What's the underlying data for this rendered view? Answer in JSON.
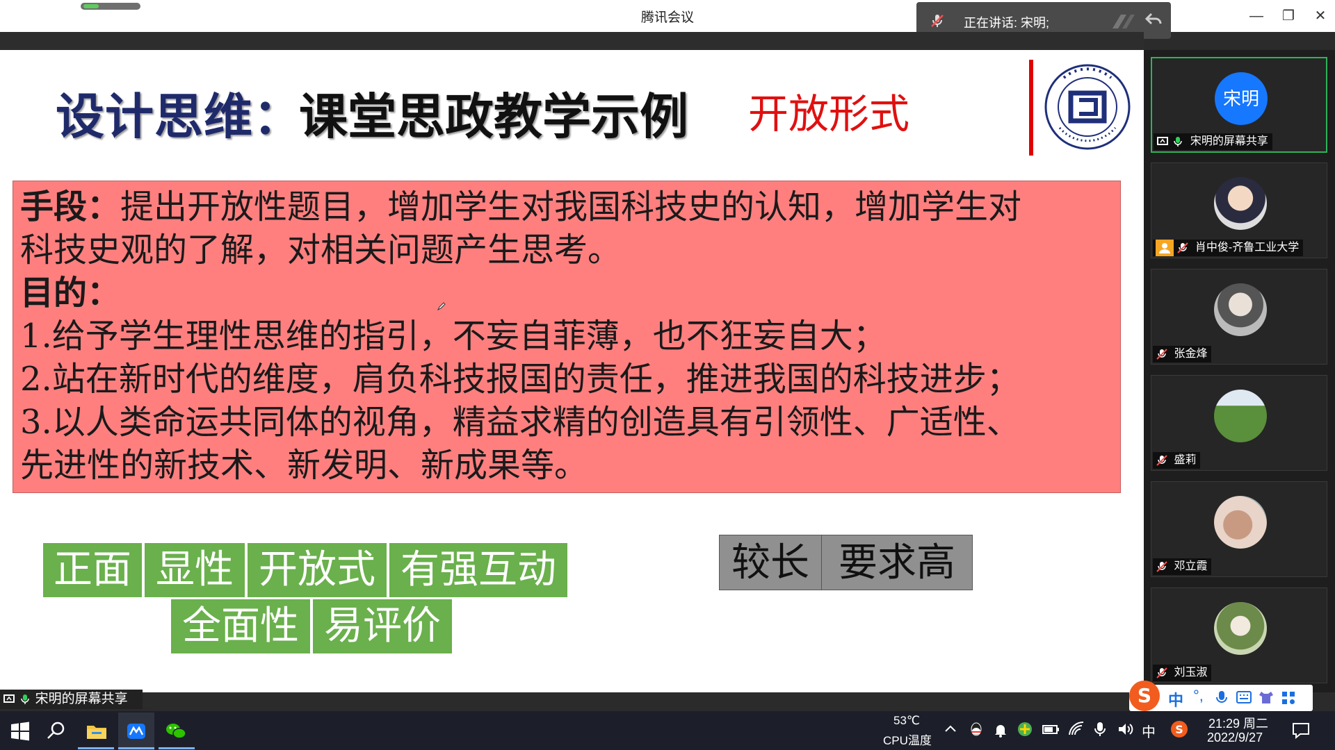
{
  "window": {
    "title": "腾讯会议",
    "speaking_label": "正在讲话: 宋明;"
  },
  "slide": {
    "title_part1": "设计思维：",
    "title_part2": "课堂思政教学示例",
    "subtitle": "开放形式",
    "lines": [
      {
        "lead": "手段：",
        "text": "提出开放性题目，增加学生对我国科技史的认知，增加学生对"
      },
      {
        "lead": "",
        "text": "科技史观的了解，对相关问题产生思考。"
      },
      {
        "lead": "目的：",
        "text": ""
      },
      {
        "lead": "",
        "text": "1.给予学生理性思维的指引，不妄自菲薄，也不狂妄自大；"
      },
      {
        "lead": "",
        "text": "2.站在新时代的维度，肩负科技报国的责任，推进我国的科技进步；"
      },
      {
        "lead": "",
        "text": "3.以人类命运共同体的视角，精益求精的创造具有引领性、广适性、"
      },
      {
        "lead": "",
        "text": "先进性的新技术、新发明、新成果等。"
      }
    ],
    "green_tags_row1": [
      "正面",
      "显性",
      "开放式",
      "有强互动"
    ],
    "green_tags_row2": [
      "全面性",
      "易评价"
    ],
    "gray_tags": [
      "较长",
      "要求高"
    ]
  },
  "participants": [
    {
      "name": "宋明的屏幕共享",
      "avatar_text": "宋明",
      "active": true,
      "mic": "on"
    },
    {
      "name": "肖中俊-齐鲁工业大学",
      "avatar_text": "",
      "active": false,
      "mic": "muted"
    },
    {
      "name": "张金烽",
      "avatar_text": "",
      "active": false,
      "mic": "muted"
    },
    {
      "name": "盛莉",
      "avatar_text": "",
      "active": false,
      "mic": "muted"
    },
    {
      "name": "邓立霞",
      "avatar_text": "",
      "active": false,
      "mic": "muted"
    },
    {
      "name": "刘玉淑",
      "avatar_text": "",
      "active": false,
      "mic": "muted"
    }
  ],
  "share_label": "宋明的屏幕共享",
  "ime": {
    "mode": "中"
  },
  "taskbar": {
    "cpu_temp": "53℃",
    "cpu_label": "CPU温度",
    "ime_indicator": "中",
    "time": "21:29 周二",
    "date": "2022/9/27"
  },
  "colors": {
    "accent_green": "#6ab04c",
    "text_box_red": "#ff7f7f",
    "title_blue": "#1f2a6b",
    "subtitle_red": "#e01010"
  }
}
